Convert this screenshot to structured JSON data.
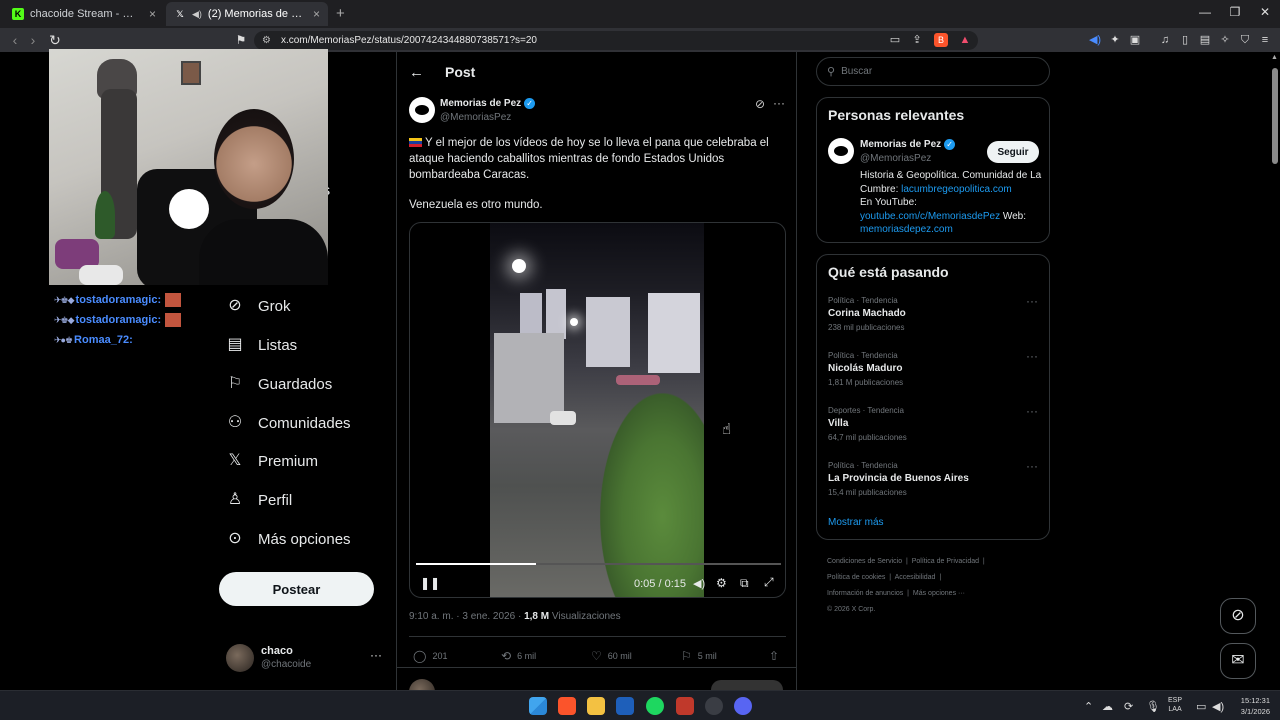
{
  "browser": {
    "tabs": [
      {
        "title": "chacoide Stream - Watch Live on",
        "active": false,
        "favicon": "kick-icon",
        "favicon_color": "#53fc18"
      },
      {
        "title": "(2) Memorias de Pez en X: \"vu",
        "active": true,
        "favicon": "x-icon",
        "audio": "speaker-icon"
      }
    ],
    "url": "x.com/MemoriasPez/status/2007424344880738571?s=20"
  },
  "stream_overlay": {
    "chat": [
      {
        "user": "tostadoramagic:",
        "color": "#4a8cff"
      },
      {
        "user": "tostadoramagic:",
        "color": "#4a8cff"
      },
      {
        "user": "Romaa_72:",
        "color": "#4a8cff"
      }
    ],
    "partial_text": "nes"
  },
  "left_nav": {
    "items": [
      {
        "label": "Grok",
        "icon": "grok-icon"
      },
      {
        "label": "Listas",
        "icon": "list-icon"
      },
      {
        "label": "Guardados",
        "icon": "bookmark-icon"
      },
      {
        "label": "Comunidades",
        "icon": "communities-icon"
      },
      {
        "label": "Premium",
        "icon": "x-icon"
      },
      {
        "label": "Perfil",
        "icon": "profile-icon"
      },
      {
        "label": "Más opciones",
        "icon": "more-icon"
      }
    ],
    "post_button": "Postear",
    "account": {
      "name": "chaco",
      "handle": "@chacoide"
    }
  },
  "post": {
    "header": "Post",
    "author": {
      "name": "Memorias de Pez",
      "handle": "@MemoriasPez"
    },
    "text_1": "Y el mejor de los vídeos de hoy se lo lleva el pana que celebraba el ataque haciendo caballitos mientras de fondo Estados Unidos bombardeaba Caracas.",
    "text_2": "Venezuela es otro mundo.",
    "video": {
      "time": "0:05 / 0:15",
      "progress": 0.33
    },
    "time": "9:10 a. m. · 3 ene. 2026 · ",
    "views_count": "1,8 M",
    "views_label": "Visualizaciones",
    "stats": {
      "replies": "201",
      "reposts": "6 mil",
      "likes": "60 mil",
      "bookmarks": "5 mil"
    }
  },
  "sidebar": {
    "search_placeholder": "Buscar",
    "relevant": {
      "title": "Personas relevantes",
      "name": "Memorias de Pez",
      "handle": "@MemoriasPez",
      "follow": "Seguir",
      "bio_1": "Historia & Geopolítica. Comunidad de La Cumbre: ",
      "bio_link_1": "lacumbregeopolitica.com",
      "bio_2": "En YouTube:",
      "bio_link_2": "youtube.com/c/MemoriasdePez",
      "bio_3": " Web:",
      "bio_link_3": "memoriasdepez.com"
    },
    "trending": {
      "title": "Qué está pasando",
      "items": [
        {
          "meta": "Política · Tendencia",
          "name": "Corina Machado",
          "count": "238 mil publicaciones"
        },
        {
          "meta": "Política · Tendencia",
          "name": "Nicolás Maduro",
          "count": "1,81 M publicaciones"
        },
        {
          "meta": "Deportes · Tendencia",
          "name": "Villa",
          "count": "64,7 mil publicaciones"
        },
        {
          "meta": "Política · Tendencia",
          "name": "La Provincia de Buenos Aires",
          "count": "15,4 mil publicaciones"
        }
      ],
      "show_more": "Mostrar más"
    },
    "footer": {
      "l1a": "Condiciones de Servicio",
      "l1b": "Política de Privacidad",
      "l2a": "Política de cookies",
      "l2b": "Accesibilidad",
      "l3a": "Información de anuncios",
      "l3b": "Más opciones ···",
      "copyright": "© 2026 X Corp."
    }
  },
  "taskbar": {
    "lang_1": "ESP",
    "lang_2": "LAA",
    "time": "15:12:31",
    "date": "3/1/2026"
  }
}
